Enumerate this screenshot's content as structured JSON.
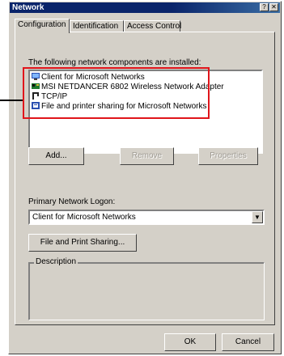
{
  "window": {
    "title": "Network",
    "help_glyph": "?",
    "close_glyph": "✕"
  },
  "tabs": [
    {
      "label": "Configuration",
      "active": true
    },
    {
      "label": "Identification",
      "active": false
    },
    {
      "label": "Access Control",
      "active": false
    }
  ],
  "components": {
    "label": "The following network components are installed:",
    "items": [
      {
        "label": "Client for Microsoft Networks",
        "icon": "client-icon"
      },
      {
        "label": "MSI NETDANCER 6802 Wireless Network Adapter",
        "icon": "adapter-icon"
      },
      {
        "label": "TCP/IP",
        "icon": "protocol-icon"
      },
      {
        "label": "File and printer sharing for Microsoft Networks",
        "icon": "service-icon"
      }
    ],
    "highlight_color": "#e0151b"
  },
  "buttons": {
    "add": "Add...",
    "remove": "Remove",
    "properties": "Properties",
    "file_print": "File and Print Sharing...",
    "ok": "OK",
    "cancel": "Cancel"
  },
  "logon": {
    "label": "Primary Network Logon:",
    "value": "Client for Microsoft Networks",
    "arrow": "▼"
  },
  "description": {
    "label": "Description"
  },
  "colors": {
    "titlebar": "#0a246a",
    "face": "#d4d0c8"
  }
}
